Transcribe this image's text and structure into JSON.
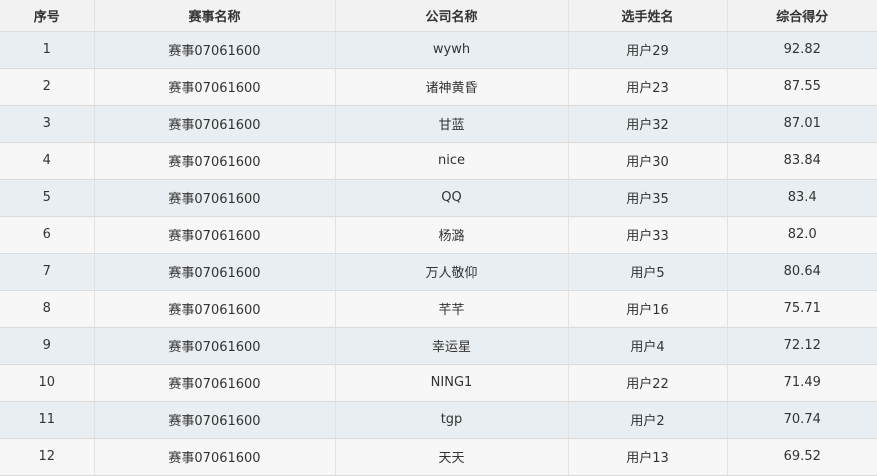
{
  "table": {
    "columns": [
      "序号",
      "赛事名称",
      "公司名称",
      "选手姓名",
      "综合得分"
    ],
    "rows": [
      [
        "1",
        "赛事07061600",
        "wywh",
        "用户29",
        "92.82"
      ],
      [
        "2",
        "赛事07061600",
        "诸神黄昏",
        "用户23",
        "87.55"
      ],
      [
        "3",
        "赛事07061600",
        "甘蓝",
        "用户32",
        "87.01"
      ],
      [
        "4",
        "赛事07061600",
        "nice",
        "用户30",
        "83.84"
      ],
      [
        "5",
        "赛事07061600",
        "QQ",
        "用户35",
        "83.4"
      ],
      [
        "6",
        "赛事07061600",
        "杨潞",
        "用户33",
        "82.0"
      ],
      [
        "7",
        "赛事07061600",
        "万人敬仰",
        "用户5",
        "80.64"
      ],
      [
        "8",
        "赛事07061600",
        "芊芊",
        "用户16",
        "75.71"
      ],
      [
        "9",
        "赛事07061600",
        "幸运星",
        "用户4",
        "72.12"
      ],
      [
        "10",
        "赛事07061600",
        "NING1",
        "用户22",
        "71.49"
      ],
      [
        "11",
        "赛事07061600",
        "tgp",
        "用户2",
        "70.74"
      ],
      [
        "12",
        "赛事07061600",
        "天天",
        "用户13",
        "69.52"
      ]
    ]
  }
}
